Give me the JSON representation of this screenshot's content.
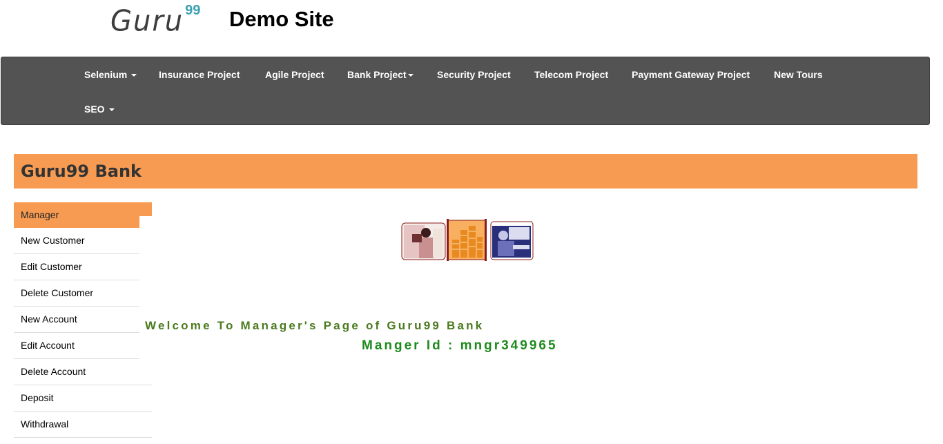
{
  "header": {
    "logo_word": "Guru",
    "logo_sup": "99",
    "site_title": "Demo Site"
  },
  "nav": {
    "selenium": "Selenium",
    "insurance": "Insurance Project",
    "agile": "Agile Project",
    "bank": "Bank Project",
    "security": "Security Project",
    "telecom": "Telecom Project",
    "payment": "Payment Gateway Project",
    "tours": "New Tours",
    "seo": "SEO"
  },
  "bank": {
    "title": "Guru99 Bank"
  },
  "menu": {
    "active": "Manager",
    "items": [
      "New Customer",
      "Edit Customer",
      "Delete Customer",
      "New Account",
      "Edit Account",
      "Delete Account",
      "Deposit",
      "Withdrawal"
    ]
  },
  "main": {
    "welcome": "Welcome To Manager's Page of Guru99 Bank",
    "manager_id": "Manger Id : mngr349965"
  },
  "colors": {
    "navbar": "#535353",
    "accent": "#f79b53",
    "welcome_text": "#4a7a1e",
    "manager_id_text": "#1d8a1d"
  }
}
